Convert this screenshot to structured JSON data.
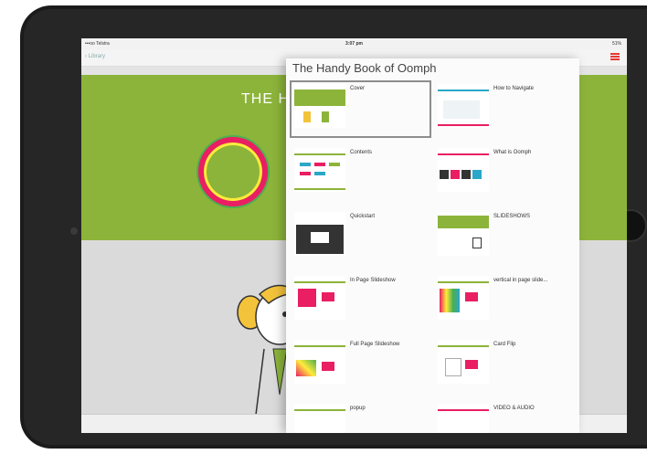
{
  "status_bar": {
    "carrier": "•••oo Telstra",
    "time": "3:07 pm",
    "battery": "51%"
  },
  "nav": {
    "back_label": "Library"
  },
  "background": {
    "title_text": "THE H"
  },
  "panel": {
    "title": "The Handy Book of Oomph",
    "items": [
      {
        "label": "Cover",
        "selected": true
      },
      {
        "label": "How to Navigate",
        "selected": false
      },
      {
        "label": "Contents",
        "selected": false
      },
      {
        "label": "What is Oomph",
        "selected": false
      },
      {
        "label": "Quickstart",
        "selected": false
      },
      {
        "label": "SLIDESHOWS",
        "selected": false
      },
      {
        "label": "In Page Slideshow",
        "selected": false
      },
      {
        "label": "vertical in page slide...",
        "selected": false
      },
      {
        "label": "Full Page Slideshow",
        "selected": false
      },
      {
        "label": "Card Flip",
        "selected": false
      },
      {
        "label": "popup",
        "selected": false
      },
      {
        "label": "VIDEO & AUDIO",
        "selected": false
      }
    ]
  },
  "colors": {
    "accent_green": "#8cb43a",
    "accent_pink": "#e91e63",
    "menu_red": "#e53935"
  }
}
